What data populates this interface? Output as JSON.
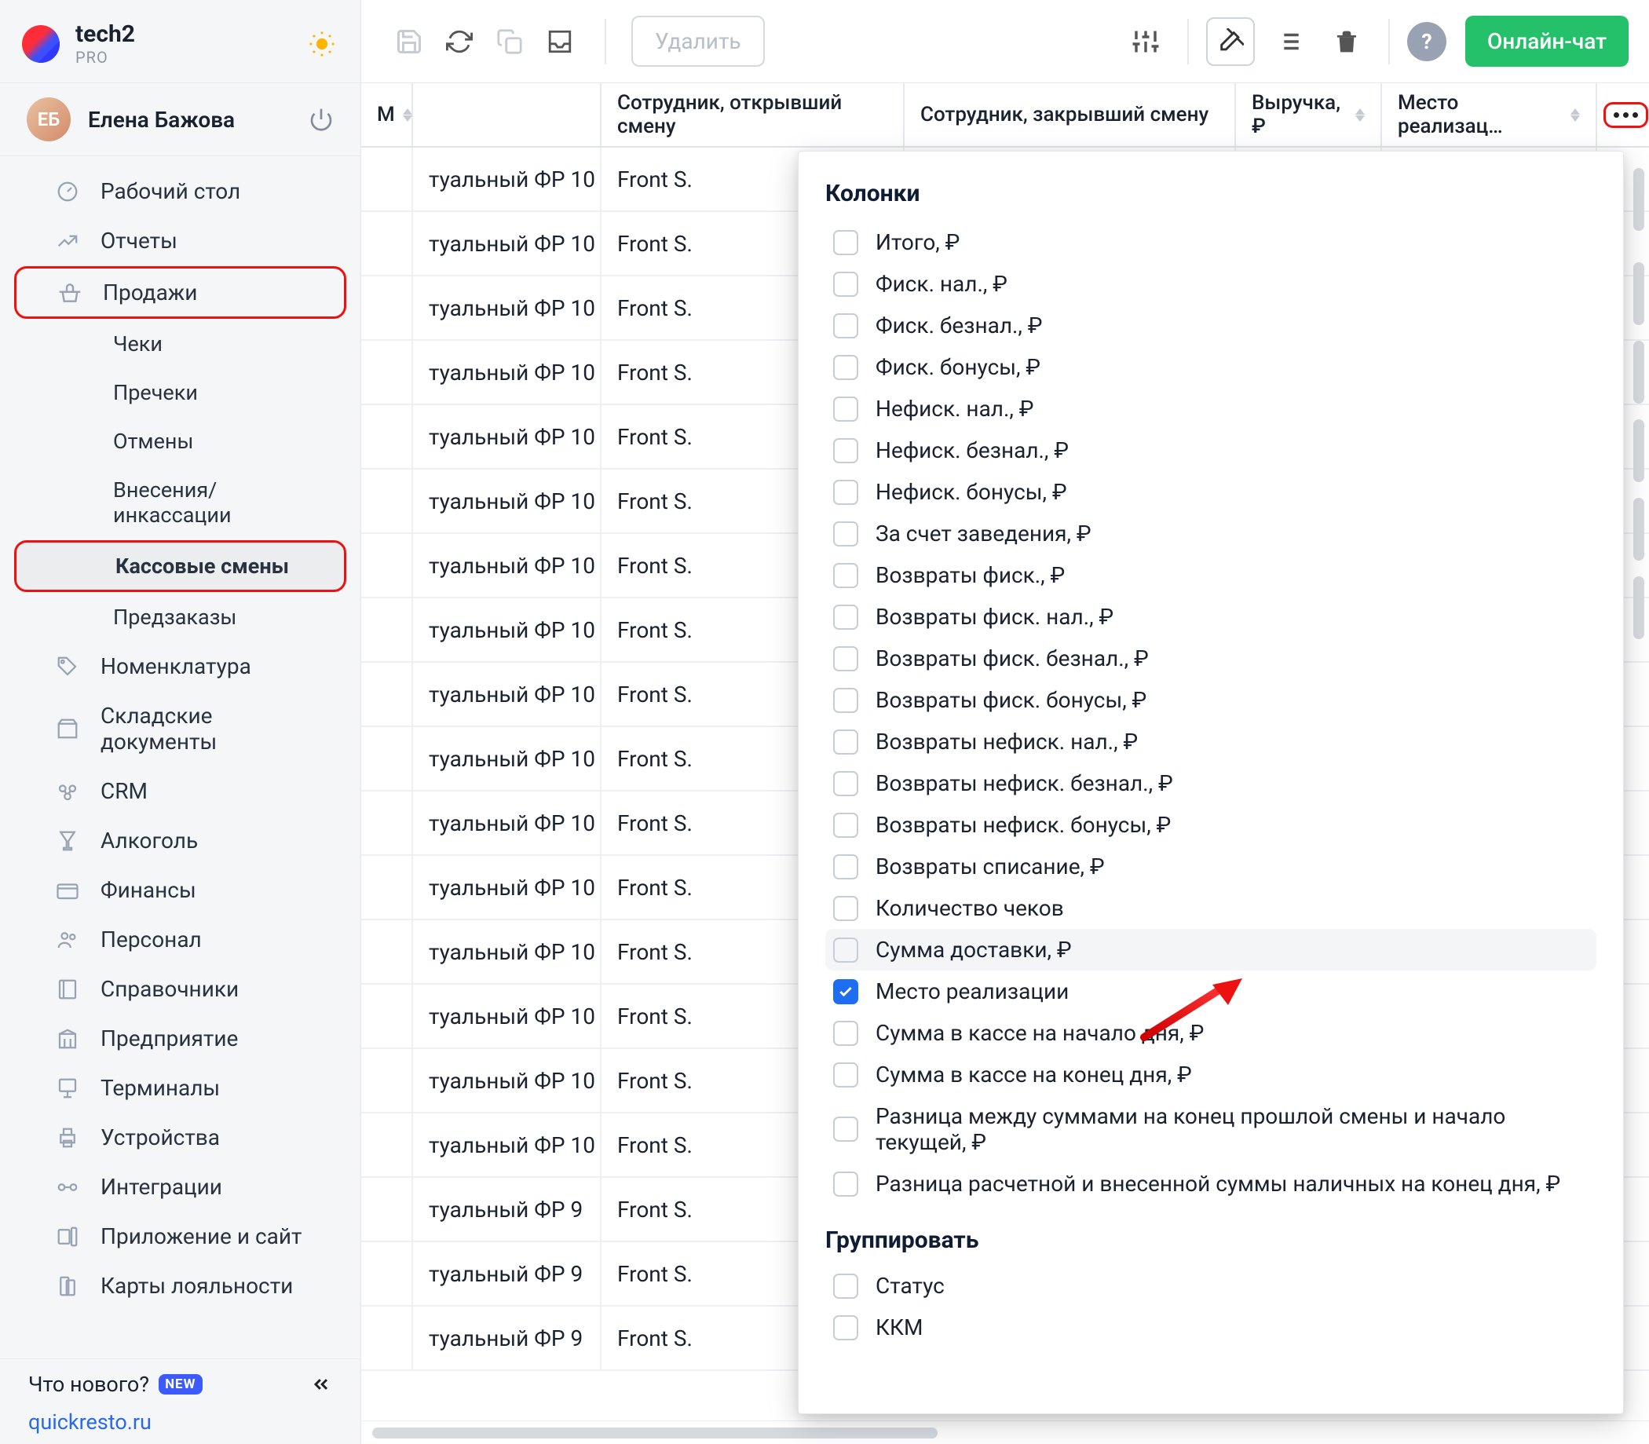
{
  "brand": {
    "title": "tech2",
    "subtitle": "PRO"
  },
  "user": {
    "name": "Елена Бажова"
  },
  "sidebar": {
    "items": [
      {
        "label": "Рабочий стол",
        "icon": "dashboard-icon",
        "level": 1
      },
      {
        "label": "Отчеты",
        "icon": "reports-icon",
        "level": 1
      },
      {
        "label": "Продажи",
        "icon": "basket-icon",
        "level": 1,
        "highlight": true,
        "sales": true
      },
      {
        "label": "Чеки",
        "level": 2
      },
      {
        "label": "Пречеки",
        "level": 2
      },
      {
        "label": "Отмены",
        "level": 2
      },
      {
        "label": "Внесения/инкассации",
        "level": 2
      },
      {
        "label": "Кассовые смены",
        "level": 2,
        "selected": true,
        "highlight": true
      },
      {
        "label": "Предзаказы",
        "level": 2
      },
      {
        "label": "Номенклатура",
        "icon": "tag-icon",
        "level": 1
      },
      {
        "label": "Складские документы",
        "icon": "box-icon",
        "level": 1
      },
      {
        "label": "CRM",
        "icon": "crm-icon",
        "level": 1
      },
      {
        "label": "Алкоголь",
        "icon": "glass-icon",
        "level": 1
      },
      {
        "label": "Финансы",
        "icon": "wallet-icon",
        "level": 1
      },
      {
        "label": "Персонал",
        "icon": "people-icon",
        "level": 1
      },
      {
        "label": "Справочники",
        "icon": "book-icon",
        "level": 1
      },
      {
        "label": "Предприятие",
        "icon": "building-icon",
        "level": 1
      },
      {
        "label": "Терминалы",
        "icon": "terminal-icon",
        "level": 1
      },
      {
        "label": "Устройства",
        "icon": "printer-icon",
        "level": 1
      },
      {
        "label": "Интеграции",
        "icon": "integration-icon",
        "level": 1
      },
      {
        "label": "Приложение и сайт",
        "icon": "app-icon",
        "level": 1
      },
      {
        "label": "Карты лояльности",
        "icon": "card-icon",
        "level": 1
      }
    ],
    "news": "Что нового?",
    "newBadge": "NEW",
    "link": "quickresto.ru"
  },
  "toolbar": {
    "delete": "Удалить",
    "chat": "Онлайн-чат"
  },
  "table": {
    "headers": [
      "М",
      "Сотрудник, открывший смену",
      "Сотрудник, закрывший смену",
      "Выручка, ₽",
      "Место реализац…"
    ],
    "rows": [
      {
        "a": "туальный ФР 10",
        "b": "Front S."
      },
      {
        "a": "туальный ФР 10",
        "b": "Front S."
      },
      {
        "a": "туальный ФР 10",
        "b": "Front S."
      },
      {
        "a": "туальный ФР 10",
        "b": "Front S."
      },
      {
        "a": "туальный ФР 10",
        "b": "Front S."
      },
      {
        "a": "туальный ФР 10",
        "b": "Front S."
      },
      {
        "a": "туальный ФР 10",
        "b": "Front S."
      },
      {
        "a": "туальный ФР 10",
        "b": "Front S."
      },
      {
        "a": "туальный ФР 10",
        "b": "Front S."
      },
      {
        "a": "туальный ФР 10",
        "b": "Front S."
      },
      {
        "a": "туальный ФР 10",
        "b": "Front S."
      },
      {
        "a": "туальный ФР 10",
        "b": "Front S."
      },
      {
        "a": "туальный ФР 10",
        "b": "Front S."
      },
      {
        "a": "туальный ФР 10",
        "b": "Front S."
      },
      {
        "a": "туальный ФР 10",
        "b": "Front S."
      },
      {
        "a": "туальный ФР 10",
        "b": "Front S."
      },
      {
        "a": "туальный ФР 9",
        "b": "Front S."
      },
      {
        "a": "туальный ФР 9",
        "b": "Front S."
      },
      {
        "a": "туальный ФР 9",
        "b": "Front S."
      }
    ]
  },
  "popover": {
    "title": "Колонки",
    "items": [
      {
        "label": "Итого, ₽",
        "checked": false
      },
      {
        "label": "Фиск. нал., ₽",
        "checked": false
      },
      {
        "label": "Фиск. безнал., ₽",
        "checked": false
      },
      {
        "label": "Фиск. бонусы, ₽",
        "checked": false
      },
      {
        "label": "Нефиск. нал., ₽",
        "checked": false
      },
      {
        "label": "Нефиск. безнал., ₽",
        "checked": false
      },
      {
        "label": "Нефиск. бонусы, ₽",
        "checked": false
      },
      {
        "label": "За счет заведения, ₽",
        "checked": false
      },
      {
        "label": "Возвраты фиск., ₽",
        "checked": false
      },
      {
        "label": "Возвраты фиск. нал., ₽",
        "checked": false
      },
      {
        "label": "Возвраты фиск. безнал., ₽",
        "checked": false
      },
      {
        "label": "Возвраты фиск. бонусы, ₽",
        "checked": false
      },
      {
        "label": "Возвраты нефиск. нал., ₽",
        "checked": false
      },
      {
        "label": "Возвраты нефиск. безнал., ₽",
        "checked": false
      },
      {
        "label": "Возвраты нефиск. бонусы, ₽",
        "checked": false
      },
      {
        "label": "Возвраты списание, ₽",
        "checked": false
      },
      {
        "label": "Количество чеков",
        "checked": false
      },
      {
        "label": "Сумма доставки, ₽",
        "checked": false,
        "hover": true
      },
      {
        "label": "Место реализации",
        "checked": true
      },
      {
        "label": "Сумма в кассе на начало дня, ₽",
        "checked": false
      },
      {
        "label": "Сумма в кассе на конец дня, ₽",
        "checked": false
      },
      {
        "label": "Разница между суммами на конец прошлой смены и начало текущей, ₽",
        "checked": false
      },
      {
        "label": "Разница расчетной и внесенной суммы наличных на конец дня, ₽",
        "checked": false
      }
    ],
    "groupTitle": "Группировать",
    "groupItems": [
      {
        "label": "Статус",
        "checked": false
      },
      {
        "label": "ККМ",
        "checked": false
      }
    ]
  }
}
